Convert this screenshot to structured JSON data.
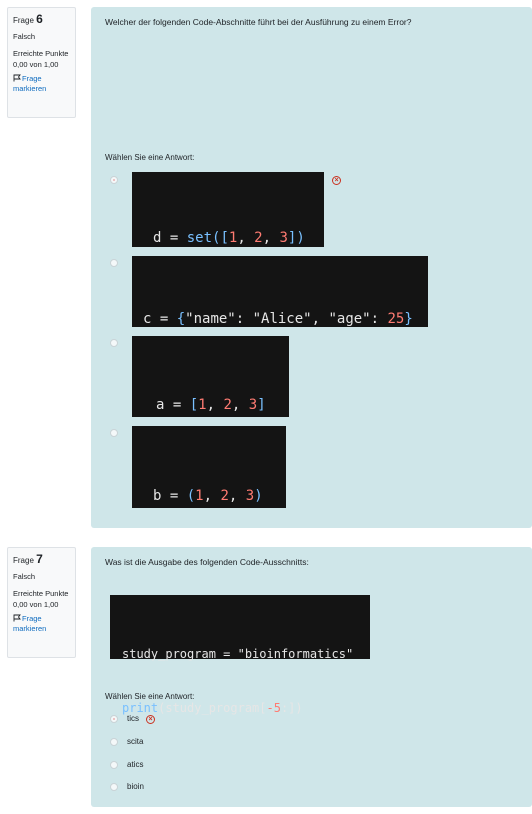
{
  "q6": {
    "label": "Frage",
    "number": "6",
    "state": "Falsch",
    "grade": "Erreichte Punkte 0,00 von 1,00",
    "flag": "Frage markieren",
    "text": "Welcher der folgenden Code-Abschnitte führt bei der Ausführung zu einem Error?",
    "prompt": "Wählen Sie eine Antwort:"
  },
  "q7": {
    "label": "Frage",
    "number": "7",
    "state": "Falsch",
    "grade": "Erreichte Punkte 0,00 von 1,00",
    "flag": "Frage markieren",
    "text": "Was ist die Ausgabe des folgenden Code-Ausschnitts:",
    "code_line1_a": "study_program = ",
    "code_line1_b": "\"bioinformatics\"",
    "code_line2_a": "print",
    "code_line2_b": "(study_program[",
    "code_line2_c": "-5",
    "code_line2_d": ":])",
    "prompt": "Wählen Sie eine Antwort:",
    "options": [
      "tics",
      "scita",
      "atics",
      "bioin"
    ]
  },
  "colors": {
    "panel": "#cfe6e9",
    "code_bg": "#141414",
    "wrong": "#ca3120",
    "link": "#0f6cbf"
  }
}
